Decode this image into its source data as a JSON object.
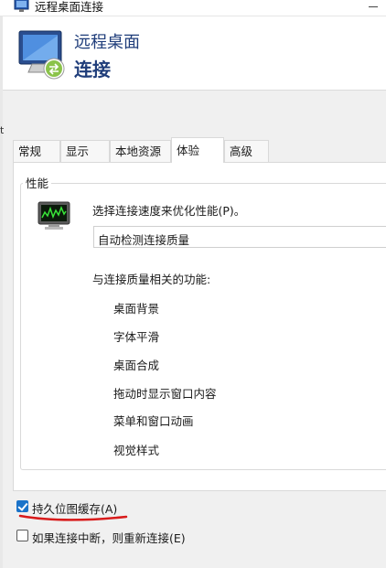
{
  "window": {
    "title": "远程桌面连接"
  },
  "header": {
    "line1": "远程桌面",
    "line2": "连接"
  },
  "tabs": [
    {
      "label": "常规"
    },
    {
      "label": "显示"
    },
    {
      "label": "本地资源"
    },
    {
      "label": "体验",
      "active": true
    },
    {
      "label": "高级"
    }
  ],
  "experience": {
    "group_label": "性能",
    "prompt": "选择连接速度来优化性能(P)。",
    "speed_select": {
      "value": "自动检测连接质量"
    },
    "features_heading": "与连接质量相关的功能:",
    "features": [
      "桌面背景",
      "字体平滑",
      "桌面合成",
      "拖动时显示窗口内容",
      "菜单和窗口动画",
      "视觉样式"
    ]
  },
  "checkboxes": [
    {
      "label": "持久位图缓存(A)",
      "checked": true
    },
    {
      "label": "如果连接中断，则重新连接(E)",
      "checked": false
    }
  ],
  "stray_char": "t",
  "colors": {
    "header_text": "#1f3d7a",
    "accent": "#1a73c9",
    "annotation": "#d81b1b"
  },
  "icons": [
    "remote-desktop-icon",
    "performance-monitor-icon"
  ]
}
